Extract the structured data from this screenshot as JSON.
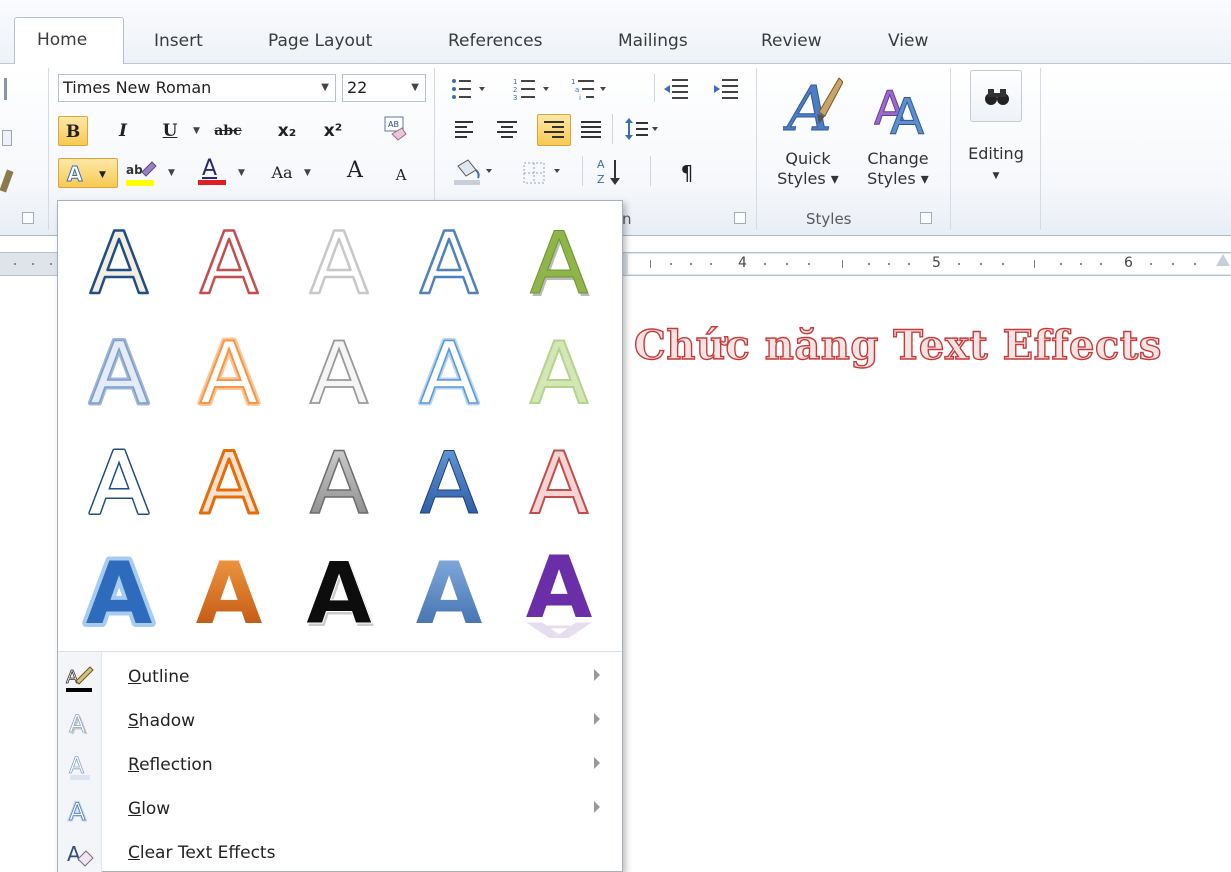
{
  "tabs": [
    {
      "label": "Home",
      "active": true
    },
    {
      "label": "Insert"
    },
    {
      "label": "Page Layout"
    },
    {
      "label": "References"
    },
    {
      "label": "Mailings"
    },
    {
      "label": "Review"
    },
    {
      "label": "View"
    }
  ],
  "font": {
    "name": "Times New Roman",
    "size": "22",
    "bold_label": "B",
    "italic_label": "I",
    "underline_label": "U",
    "strike_label": "abc",
    "subscript_label": "x₂",
    "superscript_label": "x²",
    "case_label": "Aa",
    "grow_label": "A",
    "shrink_label": "A",
    "font_color_label": "A",
    "text_effects_label": "A"
  },
  "paragraph": {
    "pilcrow": "¶",
    "group_label": "n"
  },
  "styles": {
    "quick_label_1": "Quick",
    "quick_label_2": "Styles ▾",
    "change_label_1": "Change",
    "change_label_2": "Styles ▾",
    "group_label": "Styles"
  },
  "editing": {
    "label": "Editing"
  },
  "ruler": {
    "numbers": [
      "4",
      "5",
      "6"
    ]
  },
  "document": {
    "text": "Chức năng Text Effects"
  },
  "text_effects_menu": {
    "items": [
      {
        "label": "Outline",
        "icon": "pencil-outline-icon",
        "submenu": true
      },
      {
        "label": "Shadow",
        "icon": "shadow-a-icon",
        "submenu": true
      },
      {
        "label": "Reflection",
        "icon": "reflection-a-icon",
        "submenu": true
      },
      {
        "label": "Glow",
        "icon": "glow-a-icon",
        "submenu": true
      },
      {
        "label": "Clear Text Effects",
        "icon": "eraser-a-icon",
        "submenu": false
      }
    ]
  },
  "colors": {
    "active_button": "#f8c952",
    "accent_blue": "#3a6db5",
    "doc_text_outline": "#c83a3a"
  }
}
